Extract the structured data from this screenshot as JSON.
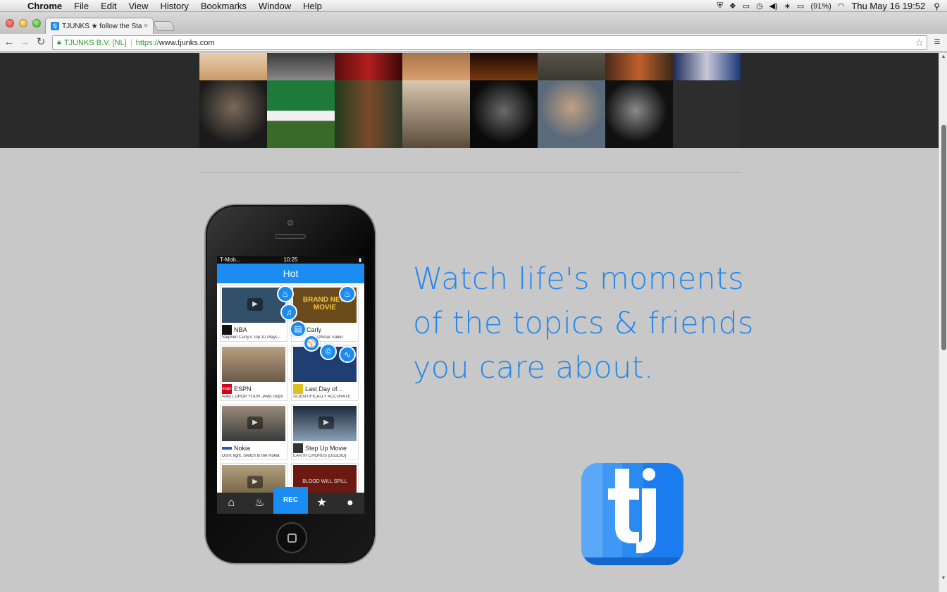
{
  "menubar": {
    "app": "Chrome",
    "items": [
      "File",
      "Edit",
      "View",
      "History",
      "Bookmarks",
      "Window",
      "Help"
    ],
    "battery": "(91%)",
    "clock": "Thu May 16  19:52"
  },
  "browser": {
    "tab_title": "TJUNKS ★ follow the Stars",
    "tab_favicon": "tj",
    "ev_label": "TJUNKS B.V. [NL]",
    "url_scheme": "https://",
    "url_host": "www.tjunks.com"
  },
  "phone": {
    "carrier": "T-Mob...",
    "time": "10:25",
    "screen_title": "Hot",
    "cards": [
      {
        "name": "NBA",
        "sub": "Stephen Curry's Top 10 Plays...",
        "logo": "",
        "thumb_color": "#33506b"
      },
      {
        "name": "iCarly",
        "sub": "Official Trailer",
        "logo": "",
        "thumb_color": "#6b4a1c",
        "thumb_text": "BRAND NEW MOVIE"
      },
      {
        "name": "ESPN",
        "sub": "Alley ( DROP YOUR JAW) Oops",
        "logo": "espn",
        "thumb_color": "#8c7860"
      },
      {
        "name": "Last Day of...",
        "sub": "SCIENTIFICALLY ACCURATE",
        "logo": "",
        "thumb_color": "#1f3e72"
      },
      {
        "name": "Nokia",
        "sub": "Don't fight. Switch to the Nokia",
        "logo": "",
        "thumb_color": "#6a6a6a"
      },
      {
        "name": "Step Up Movie",
        "sub": "EARTH CHORUS [DS2DIO]",
        "logo": "",
        "thumb_color": "#1e2a3a"
      },
      {
        "name": "",
        "sub": "",
        "logo": "",
        "thumb_color": "#7a6a4a"
      },
      {
        "name": "",
        "sub": "",
        "logo": "",
        "thumb_color": "#6b1a12",
        "thumb_text": "BLOOD WILL SPILL"
      }
    ],
    "tabbar": {
      "rec_label": "REC"
    }
  },
  "tagline": {
    "line1": "Watch life's moments",
    "line2": "of the topics & friends",
    "line3": "you care about."
  },
  "colors": {
    "accent": "#2186ee",
    "page_bg": "#c8c8c8",
    "hero_bg": "#2a2a2a"
  }
}
